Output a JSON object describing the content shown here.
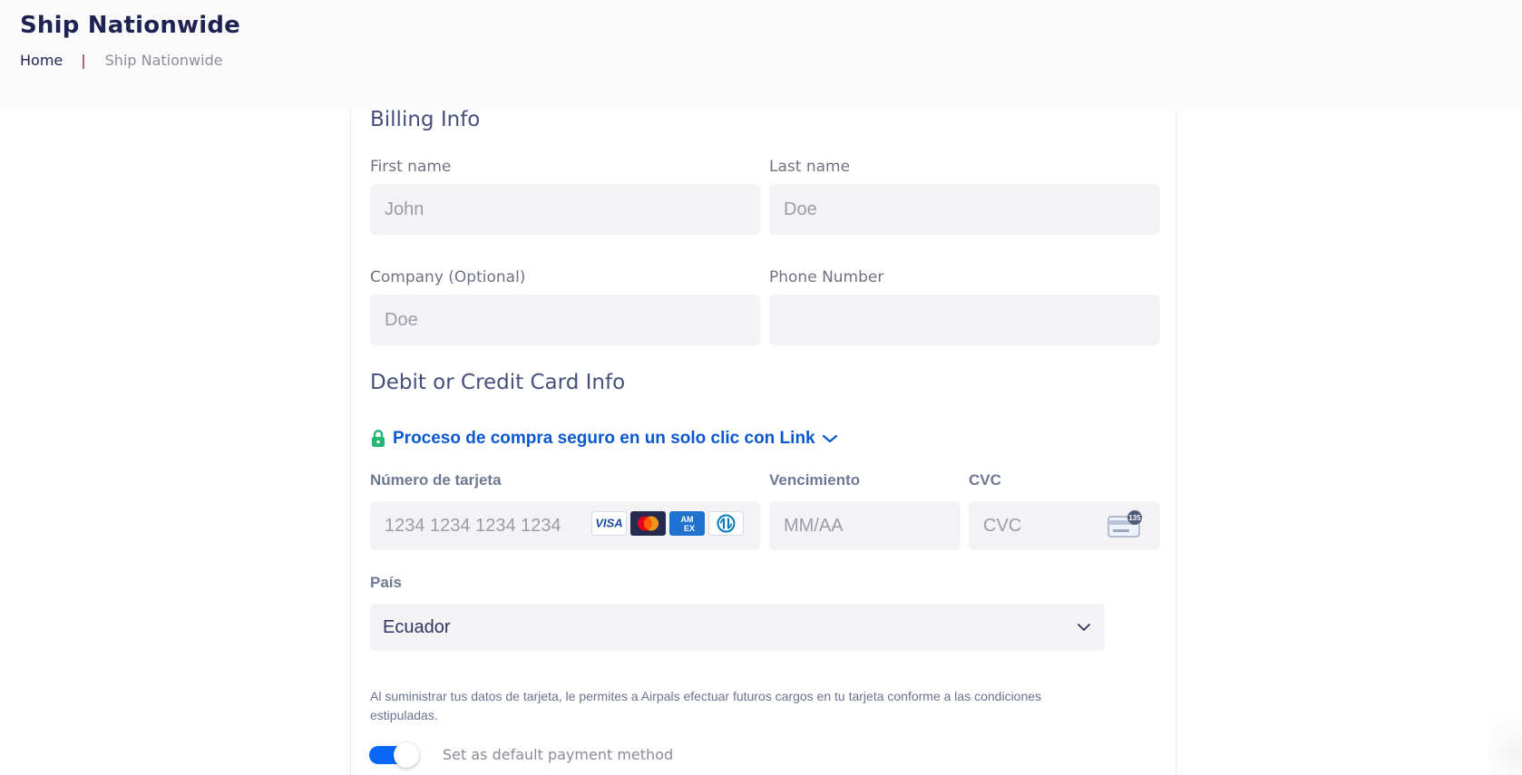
{
  "header": {
    "title": "Ship Nationwide",
    "breadcrumb": {
      "home": "Home",
      "separator": "|",
      "current": "Ship Nationwide"
    }
  },
  "billing": {
    "title": "Billing Info",
    "first_name": {
      "label": "First name",
      "value": "",
      "placeholder": "John"
    },
    "last_name": {
      "label": "Last name",
      "value": "",
      "placeholder": "Doe"
    },
    "company": {
      "label": "Company (Optional)",
      "value": "",
      "placeholder": "Doe"
    },
    "phone": {
      "label": "Phone Number",
      "value": "",
      "placeholder": ""
    }
  },
  "payment": {
    "title": "Debit or Credit Card Info",
    "secure_checkout_text": "Proceso de compra seguro en un solo clic con Link",
    "secure_checkout_icon": "lock-icon",
    "card_number": {
      "label": "Número de tarjeta",
      "value": "",
      "placeholder": "1234 1234 1234 1234"
    },
    "card_brands": {
      "visa": "VISA",
      "amex_top": "AM",
      "amex_bottom": "EX"
    },
    "expiry": {
      "label": "Vencimiento",
      "value": "",
      "placeholder": "MM/AA"
    },
    "cvc": {
      "label": "CVC",
      "value": "",
      "placeholder": "CVC",
      "badge": "135"
    },
    "country": {
      "label": "País",
      "selected": "Ecuador"
    },
    "consent_text": "Al suministrar tus datos de tarjeta, le permites a Airpals efectuar futuros cargos en tu tarjeta conforme a las condiciones estipuladas.",
    "default_payment": {
      "label": "Set as default payment method",
      "enabled": true
    }
  },
  "colors": {
    "header_title": "#1f2353",
    "secure_link": "#0a58d0",
    "toggle_active": "#0967f8",
    "input_background": "#f3f3f5",
    "separator": "#8b1e2d"
  }
}
